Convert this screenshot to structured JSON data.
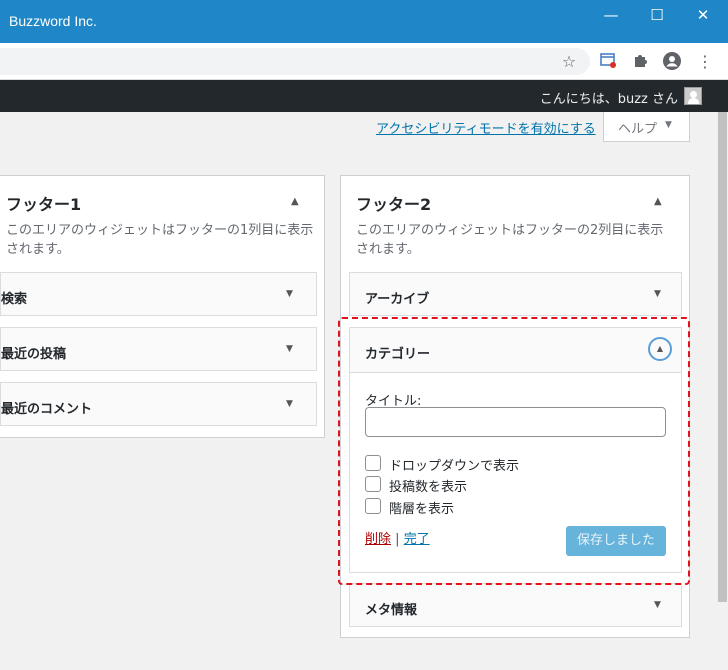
{
  "window": {
    "title": "Buzzword Inc.",
    "minimize_icon": "minimize-icon",
    "maximize_icon": "maximize-icon",
    "close_icon": "close-icon"
  },
  "adminbar": {
    "greeting": "こんにちは、buzz さん"
  },
  "screen_options": {
    "accessibility_link": "アクセシビリティモードを有効にする",
    "help_label": "ヘルプ"
  },
  "sidebars": [
    {
      "title": "フッター1",
      "description": "このエリアのウィジェットはフッターの1列目に表示されます。",
      "widgets": [
        "検索",
        "最近の投稿",
        "最近のコメント"
      ]
    },
    {
      "title": "フッター2",
      "description": "このエリアのウィジェットはフッターの2列目に表示されます。",
      "widgets": [
        "アーカイブ",
        "カテゴリー",
        "メタ情報"
      ]
    }
  ],
  "category_widget": {
    "title_label": "タイトル:",
    "title_value": "",
    "options": [
      "ドロップダウンで表示",
      "投稿数を表示",
      "階層を表示"
    ],
    "delete_label": "削除",
    "separator": "|",
    "done_label": "完了",
    "save_label": "保存しました"
  },
  "colors": {
    "titlebar": "#1f87c8",
    "adminbar": "#23282d",
    "link": "#0073aa",
    "delete": "#a00000",
    "save_disabled": "#66b3dc",
    "highlight": "#e0121a"
  }
}
